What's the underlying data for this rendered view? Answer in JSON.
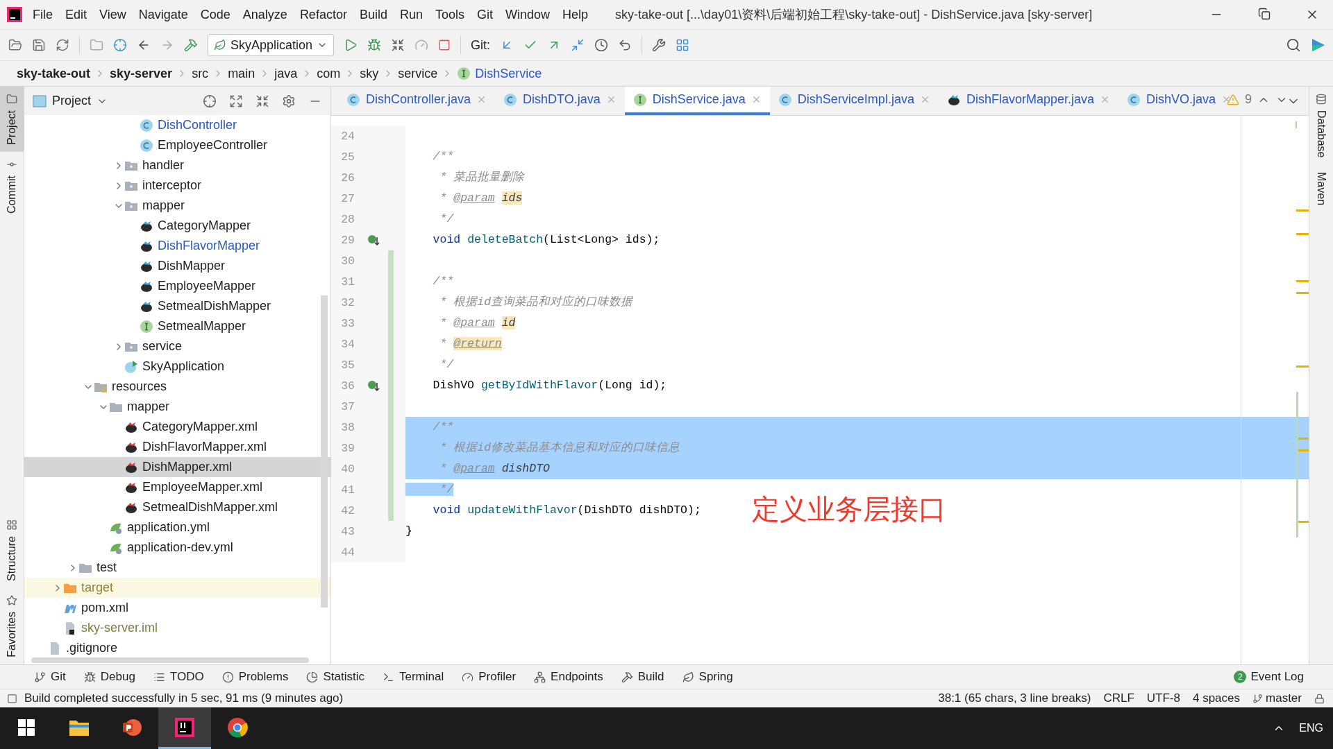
{
  "menu": [
    "File",
    "Edit",
    "View",
    "Navigate",
    "Code",
    "Analyze",
    "Refactor",
    "Build",
    "Run",
    "Tools",
    "Git",
    "Window",
    "Help"
  ],
  "title": "sky-take-out [...\\day01\\资料\\后端初始工程\\sky-take-out] - DishService.java [sky-server]",
  "toolbar": {
    "run_config": "SkyApplication",
    "git_label": "Git:"
  },
  "breadcrumb": [
    {
      "label": "sky-take-out",
      "kind": "module"
    },
    {
      "label": "sky-server",
      "kind": "module"
    },
    {
      "label": "src",
      "kind": "folder"
    },
    {
      "label": "main",
      "kind": "folder"
    },
    {
      "label": "java",
      "kind": "folder"
    },
    {
      "label": "com",
      "kind": "folder"
    },
    {
      "label": "sky",
      "kind": "folder"
    },
    {
      "label": "service",
      "kind": "folder"
    },
    {
      "label": "DishService",
      "kind": "interface"
    }
  ],
  "side_left": [
    {
      "label": "Project",
      "selected": true
    },
    {
      "label": "Commit",
      "selected": false
    },
    {
      "label": "Structure",
      "selected": false
    },
    {
      "label": "Favorites",
      "selected": false
    }
  ],
  "side_right": [
    {
      "label": "Database"
    },
    {
      "label": "Maven"
    }
  ],
  "project_panel": {
    "title": "Project"
  },
  "tree": [
    {
      "children": [
        {
          "children": [
            {
              "children": [
                {
                  "children": [
                    {
                      "children": [
                        {
                          "children": [
                            {
                              "label": "DishController",
                              "kind": "class",
                              "color": "#2a57c4",
                              "selected": false
                            },
                            {
                              "label": "EmployeeController",
                              "kind": "class",
                              "color": "#1e1e1e",
                              "selected": false
                            }
                          ]
                        },
                        {
                          "label": "handler",
                          "kind": "package",
                          "color": "#1e1e1e",
                          "selected": false,
                          "expanded": false
                        },
                        {
                          "label": "interceptor",
                          "kind": "package",
                          "color": "#1e1e1e",
                          "selected": false,
                          "expanded": false
                        },
                        {
                          "label": "mapper",
                          "kind": "package",
                          "color": "#1e1e1e",
                          "selected": false,
                          "expanded": true,
                          "children": [
                            {
                              "label": "CategoryMapper",
                              "kind": "mapper",
                              "color": "#1e1e1e",
                              "selected": false
                            },
                            {
                              "label": "DishFlavorMapper",
                              "kind": "mapper",
                              "color": "#2a57c4",
                              "selected": false
                            },
                            {
                              "label": "DishMapper",
                              "kind": "mapper",
                              "color": "#1e1e1e",
                              "selected": false
                            },
                            {
                              "label": "EmployeeMapper",
                              "kind": "mapper",
                              "color": "#1e1e1e",
                              "selected": false
                            },
                            {
                              "label": "SetmealDishMapper",
                              "kind": "mapper",
                              "color": "#1e1e1e",
                              "selected": false
                            },
                            {
                              "label": "SetmealMapper",
                              "kind": "interface",
                              "color": "#1e1e1e",
                              "selected": false
                            }
                          ]
                        },
                        {
                          "label": "service",
                          "kind": "package",
                          "color": "#1e1e1e",
                          "selected": false,
                          "expanded": false
                        },
                        {
                          "label": "SkyApplication",
                          "kind": "app",
                          "color": "#1e1e1e",
                          "selected": false
                        }
                      ]
                    }
                  ]
                },
                {
                  "label": "resources",
                  "kind": "resources",
                  "color": "#1e1e1e",
                  "selected": false,
                  "expanded": true,
                  "children": [
                    {
                      "label": "mapper",
                      "kind": "folder",
                      "color": "#1e1e1e",
                      "selected": false,
                      "expanded": true,
                      "children": [
                        {
                          "label": "CategoryMapper.xml",
                          "kind": "xml",
                          "color": "#1e1e1e",
                          "selected": false
                        },
                        {
                          "label": "DishFlavorMapper.xml",
                          "kind": "xml",
                          "color": "#1e1e1e",
                          "selected": false
                        },
                        {
                          "label": "DishMapper.xml",
                          "kind": "xml",
                          "color": "#1e1e1e",
                          "selected": true
                        },
                        {
                          "label": "EmployeeMapper.xml",
                          "kind": "xml",
                          "color": "#1e1e1e",
                          "selected": false
                        },
                        {
                          "label": "SetmealDishMapper.xml",
                          "kind": "xml",
                          "color": "#1e1e1e",
                          "selected": false
                        }
                      ]
                    },
                    {
                      "label": "application.yml",
                      "kind": "yml",
                      "color": "#1e1e1e",
                      "selected": false
                    },
                    {
                      "label": "application-dev.yml",
                      "kind": "yml",
                      "color": "#1e1e1e",
                      "selected": false
                    }
                  ]
                }
              ]
            },
            {
              "label": "test",
              "kind": "folder",
              "color": "#1e1e1e",
              "selected": false,
              "expanded": false
            }
          ]
        },
        {
          "label": "target",
          "kind": "excluded-folder",
          "color": "#93803a",
          "selected": false,
          "expanded": false
        },
        {
          "label": "pom.xml",
          "kind": "maven",
          "color": "#1e1e1e",
          "selected": false
        },
        {
          "label": "sky-server.iml",
          "kind": "iml",
          "color": "#7f7d3c",
          "selected": false
        }
      ]
    },
    {
      "label": ".gitignore",
      "kind": "file",
      "color": "#1e1e1e",
      "selected": false
    }
  ],
  "tabs": [
    {
      "label": "DishController.java",
      "kind": "class",
      "selected": false
    },
    {
      "label": "DishDTO.java",
      "kind": "class",
      "selected": false
    },
    {
      "label": "DishService.java",
      "kind": "interface",
      "selected": true
    },
    {
      "label": "DishServiceImpl.java",
      "kind": "class",
      "selected": false
    },
    {
      "label": "DishFlavorMapper.java",
      "kind": "mapper",
      "selected": false
    },
    {
      "label": "DishVO.java",
      "kind": "class",
      "selected": false
    }
  ],
  "warnings": "9",
  "lines": [
    {
      "number": "24",
      "selected": false,
      "changed": false,
      "implemented": false
    },
    {
      "number": "25",
      "tokens": [
        {
          "kind": "comment",
          "text": "    /**"
        }
      ],
      "selected": false,
      "changed": false,
      "implemented": false
    },
    {
      "number": "26",
      "tokens": [
        {
          "kind": "comment",
          "text": "     * 菜品批量删除"
        }
      ],
      "selected": false,
      "changed": false,
      "implemented": false
    },
    {
      "number": "27",
      "tokens": [
        {
          "kind": "comment",
          "text": "     * "
        },
        {
          "kind": "doc-tag",
          "text": "@param"
        },
        {
          "kind": "doc-param-marked",
          "text": "ids"
        }
      ],
      "selected": false,
      "changed": false,
      "implemented": false
    },
    {
      "number": "28",
      "tokens": [
        {
          "kind": "comment",
          "text": "     */"
        }
      ],
      "selected": false,
      "changed": false,
      "implemented": false
    },
    {
      "number": "29",
      "tokens": [
        {
          "kind": "keyword",
          "text": "    void "
        },
        {
          "kind": "method",
          "text": "deleteBatch"
        },
        {
          "kind": "plain",
          "text": "(List<Long> ids);"
        }
      ],
      "selected": false,
      "changed": false,
      "implemented": true
    },
    {
      "number": "30",
      "selected": false,
      "changed": true,
      "implemented": false
    },
    {
      "number": "31",
      "tokens": [
        {
          "kind": "comment",
          "text": "    /**"
        }
      ],
      "selected": false,
      "changed": true,
      "implemented": false
    },
    {
      "number": "32",
      "tokens": [
        {
          "kind": "comment",
          "text": "     * 根据id查询菜品和对应的口味数据"
        }
      ],
      "selected": false,
      "changed": true,
      "implemented": false
    },
    {
      "number": "33",
      "tokens": [
        {
          "kind": "comment",
          "text": "     * "
        },
        {
          "kind": "doc-tag",
          "text": "@param"
        },
        {
          "kind": "doc-param-marked",
          "text": "id"
        }
      ],
      "selected": false,
      "changed": true,
      "implemented": false
    },
    {
      "number": "34",
      "tokens": [
        {
          "kind": "comment",
          "text": "     * "
        },
        {
          "kind": "doc-tag-marked",
          "text": "@return"
        }
      ],
      "selected": false,
      "changed": true,
      "implemented": false
    },
    {
      "number": "35",
      "tokens": [
        {
          "kind": "comment",
          "text": "     */"
        }
      ],
      "selected": false,
      "changed": true,
      "implemented": false
    },
    {
      "number": "36",
      "tokens": [
        {
          "kind": "plain",
          "text": "    DishVO "
        },
        {
          "kind": "method",
          "text": "getByIdWithFlavor"
        },
        {
          "kind": "plain",
          "text": "(Long id);"
        }
      ],
      "selected": false,
      "changed": true,
      "implemented": true
    },
    {
      "number": "37",
      "selected": false,
      "changed": true,
      "implemented": false
    },
    {
      "number": "38",
      "tokens": [
        {
          "kind": "comment",
          "text": "    /**"
        }
      ],
      "selected": true,
      "changed": true,
      "implemented": false
    },
    {
      "number": "39",
      "tokens": [
        {
          "kind": "comment",
          "text": "     * 根据id修改菜品基本信息和对应的口味信息"
        }
      ],
      "selected": true,
      "changed": true,
      "implemented": false
    },
    {
      "number": "40",
      "tokens": [
        {
          "kind": "comment",
          "text": "     * "
        },
        {
          "kind": "doc-tag",
          "text": "@param"
        },
        {
          "kind": "doc-param",
          "text": "dishDTO"
        }
      ],
      "selected": true,
      "changed": true,
      "implemented": false
    },
    {
      "number": "41",
      "tokens": [
        {
          "kind": "selected-comment",
          "text": "     */"
        }
      ],
      "selected": false,
      "changed": true,
      "implemented": false
    },
    {
      "number": "42",
      "tokens": [
        {
          "kind": "keyword",
          "text": "    void "
        },
        {
          "kind": "method",
          "text": "updateWithFlavor"
        },
        {
          "kind": "plain",
          "text": "(DishDTO dishDTO);"
        }
      ],
      "selected": false,
      "changed": true,
      "implemented": false
    },
    {
      "number": "43",
      "tokens": [
        {
          "kind": "plain",
          "text": "}"
        }
      ],
      "selected": false,
      "changed": false,
      "implemented": false
    },
    {
      "number": "44",
      "selected": false,
      "changed": false,
      "implemented": false
    }
  ],
  "annotation": "定义业务层接口",
  "tool_windows": [
    {
      "label": "Git",
      "kind": "git"
    },
    {
      "label": "Debug",
      "kind": "bug"
    },
    {
      "label": "TODO",
      "kind": "list"
    },
    {
      "label": "Problems",
      "kind": "alert"
    },
    {
      "label": "Statistic",
      "kind": "pie"
    },
    {
      "label": "Terminal",
      "kind": "terminal"
    },
    {
      "label": "Profiler",
      "kind": "gauge"
    },
    {
      "label": "Endpoints",
      "kind": "network"
    },
    {
      "label": "Build",
      "kind": "hammer"
    },
    {
      "label": "Spring",
      "kind": "leaf"
    }
  ],
  "event_log": {
    "label": "Event Log",
    "badge": "2"
  },
  "status_bar": {
    "message": "Build completed successfully in 5 sec, 91 ms (9 minutes ago)",
    "position": "38:1 (65 chars, 3 line breaks)",
    "line_separator": "CRLF",
    "encoding": "UTF-8",
    "indent": "4 spaces",
    "branch": "master"
  },
  "taskbar": {
    "apps": [
      {
        "kind": "explorer",
        "selected": false
      },
      {
        "kind": "slides",
        "selected": false
      },
      {
        "kind": "ide",
        "selected": true
      },
      {
        "kind": "browser",
        "selected": false
      }
    ],
    "language": "ENG"
  }
}
